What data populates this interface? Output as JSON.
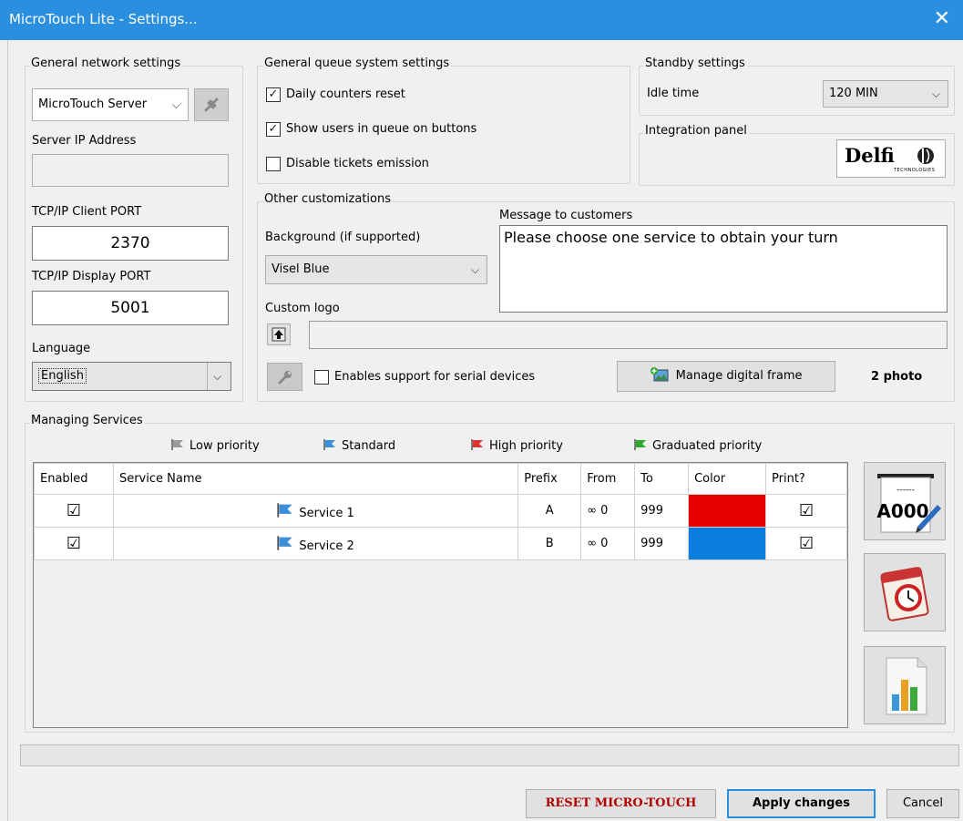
{
  "window": {
    "title": "MicroTouch Lite - Settings...",
    "close_glyph": "✕"
  },
  "network": {
    "legend": "General network settings",
    "server_mode": "MicroTouch Server",
    "server_ip_label": "Server IP Address",
    "server_ip_value": "",
    "tcp_client_label": "TCP/IP Client PORT",
    "tcp_client_value": "2370",
    "tcp_display_label": "TCP/IP Display PORT",
    "tcp_display_value": "5001",
    "language_label": "Language",
    "language_value": "English"
  },
  "queue": {
    "legend": "General queue system settings",
    "options": [
      {
        "label": "Daily counters reset",
        "checked": true
      },
      {
        "label": "Show users in queue on buttons",
        "checked": true
      },
      {
        "label": "Disable tickets emission",
        "checked": false
      }
    ]
  },
  "standby": {
    "legend": "Standby settings",
    "idle_label": "Idle time",
    "idle_value": "120 MIN"
  },
  "integration": {
    "legend": "Integration panel",
    "logo_text": "Delfi",
    "logo_sub": "TECHNOLOGIES"
  },
  "other": {
    "legend": "Other customizations",
    "background_label": "Background (if supported)",
    "background_value": "Visel Blue",
    "message_label": "Message to customers",
    "message_value": "Please choose one service to obtain your turn",
    "custom_logo_label": "Custom logo",
    "custom_logo_value": "",
    "serial_label": "Enables support for serial devices",
    "serial_checked": false,
    "manage_frame_label": "Manage digital frame",
    "photo_count": "2 photo"
  },
  "services": {
    "legend": "Managing Services",
    "priorities": [
      {
        "label": "Low priority",
        "color": "#9a9a9a"
      },
      {
        "label": "Standard",
        "color": "#3b8fd9"
      },
      {
        "label": "High priority",
        "color": "#e03030"
      },
      {
        "label": "Graduated priority",
        "color": "#2aaa2a"
      }
    ],
    "columns": [
      "Enabled",
      "Service Name",
      "Prefix",
      "From",
      "To",
      "Color",
      "Print?"
    ],
    "rows": [
      {
        "enabled": "☑",
        "name": "Service 1",
        "prefix": "A",
        "from": "∞ 0",
        "to": "999",
        "color": "#e60000",
        "print": "☑"
      },
      {
        "enabled": "☑",
        "name": "Service 2",
        "prefix": "B",
        "from": "∞ 0",
        "to": "999",
        "color": "#0a7fe0",
        "print": "☑"
      }
    ],
    "ticket_icon_text": "A000",
    "ticket_icon_dashes": "------"
  },
  "footer": {
    "reset_label": "RESET MICRO-TOUCH",
    "apply_label": "Apply changes",
    "cancel_label": "Cancel"
  },
  "colors": {
    "titlebar": "#2b8fe0",
    "reset_text": "#b00000"
  }
}
